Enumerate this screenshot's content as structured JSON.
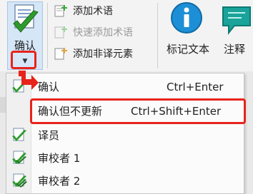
{
  "ribbon": {
    "confirm_label": "确认",
    "add_term_label": "添加术语",
    "quick_add_term_label": "快速添加术语",
    "add_non_translatable_label": "添加非译元素",
    "mark_text_label": "标记文本",
    "note_label": "注释"
  },
  "menu": {
    "items": [
      {
        "label": "确认",
        "shortcut": "Ctrl+Enter"
      },
      {
        "label": "确认但不更新",
        "shortcut": "Ctrl+Shift+Enter"
      },
      {
        "label": "译员",
        "shortcut": ""
      },
      {
        "label": "审校者 1",
        "shortcut": ""
      },
      {
        "label": "审校者 2",
        "shortcut": ""
      }
    ]
  },
  "colors": {
    "highlight_red": "#e8231a",
    "check_green": "#2e9b2e",
    "info_blue": "#1d8fd6",
    "note_teal": "#1aa39a"
  },
  "icons": [
    "document-check-icon",
    "add-term-icon",
    "quick-add-term-icon",
    "add-non-translatable-icon",
    "info-icon",
    "note-icon",
    "dropdown-arrow-icon",
    "red-arrow-icon"
  ]
}
